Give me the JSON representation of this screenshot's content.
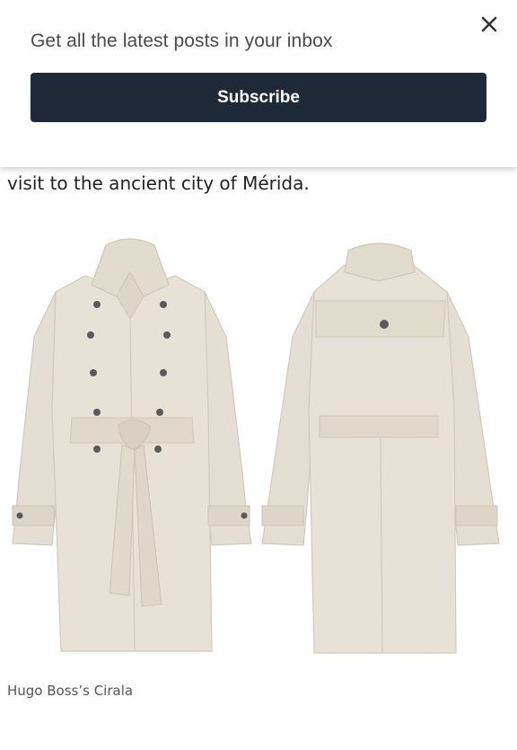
{
  "banner": {
    "message": "Get all the latest posts in your inbox",
    "subscribe_label": "Subscribe",
    "close_icon": "close-icon"
  },
  "article": {
    "text": "visit to the ancient city of Mérida."
  },
  "image": {
    "caption": "Hugo Boss’s Cirala"
  },
  "colors": {
    "button_bg": "#1f2a38",
    "coat": "#e5dfd3",
    "coat_shade": "#d2cabb",
    "button_dark": "#5b5b5e"
  }
}
